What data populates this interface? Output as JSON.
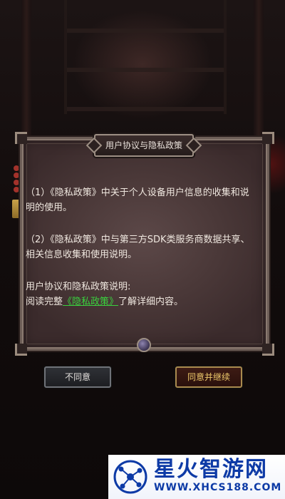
{
  "dialog": {
    "title": "用户协议与隐私政策",
    "paragraphs": [
      "（1）《隐私政策》中关于个人设备用户信息的收集和说明的使用。",
      "（2）《隐私政策》中与第三方SDK类服务商数据共享、相关信息收集和使用说明。"
    ],
    "notice_line1": "用户协议和隐私政策说明:",
    "notice_prefix": "阅读完整",
    "notice_link": "《隐私政策》",
    "notice_suffix": "了解详细内容。"
  },
  "buttons": {
    "disagree": "不同意",
    "agree": "同意并继续"
  },
  "watermark": {
    "title": "星火智游网",
    "url": "WWW.XHCS188.COM"
  },
  "colors": {
    "link": "#3ad13e",
    "agree_text": "#f0cb6c",
    "watermark_blue": "#0d3aa6"
  }
}
